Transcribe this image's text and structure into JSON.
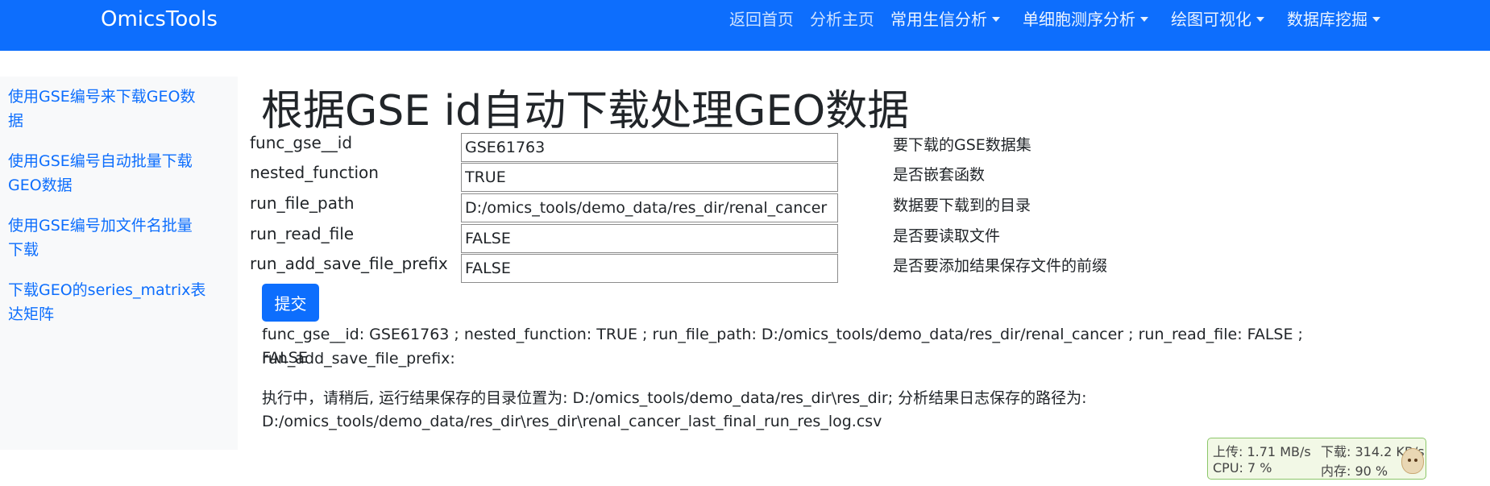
{
  "navbar": {
    "brand": "OmicsTools",
    "links": [
      "返回首页",
      "分析主页"
    ],
    "dropdowns": [
      "常用生信分析",
      "单细胞测序分析",
      "绘图可视化",
      "数据库挖掘"
    ]
  },
  "sidebar": {
    "items": [
      {
        "line1": "使用GSE编号来下载GEO数",
        "line2": "据"
      },
      {
        "line1": "使用GSE编号自动批量下载",
        "line2": "GEO数据"
      },
      {
        "line1": "使用GSE编号加文件名批量",
        "line2": "下载"
      },
      {
        "line1": "下载GEO的series_matrix表",
        "line2": "达矩阵"
      }
    ]
  },
  "page_title": "根据GSE id自动下载处理GEO数据",
  "form": {
    "rows": [
      {
        "label": "func_gse__id",
        "value": "GSE61763",
        "desc": "要下载的GSE数据集"
      },
      {
        "label": "nested_function",
        "value": "TRUE",
        "desc": "是否嵌套函数"
      },
      {
        "label": "run_file_path",
        "value": "D:/omics_tools/demo_data/res_dir/renal_cancer",
        "desc": "数据要下载到的目录"
      },
      {
        "label": "run_read_file",
        "value": "FALSE",
        "desc": "是否要读取文件"
      },
      {
        "label": "run_add_save_file_prefix",
        "value": "FALSE",
        "desc": "是否要添加结果保存文件的前缀"
      }
    ],
    "submit_label": "提交"
  },
  "output": {
    "params_line1": "func_gse__id: GSE61763 ; nested_function: TRUE ; run_file_path: D:/omics_tools/demo_data/res_dir/renal_cancer ; run_read_file: FALSE ; run_add_save_file_prefix:",
    "params_line2": "FALSE",
    "status_line1": "执行中，请稍后, 运行结果保存的目录位置为: D:/omics_tools/demo_data/res_dir\\res_dir; 分析结果日志保存的路径为:",
    "status_line2": "D:/omics_tools/demo_data/res_dir\\res_dir\\renal_cancer_last_final_run_res_log.csv"
  },
  "net_widget": {
    "upload": "上传: 1.71 MB/s",
    "download": "下载: 314.2 KB/s",
    "cpu": "CPU: 7 %",
    "memory": "内存: 90 %",
    "mascot_icon": "cat-mascot-icon"
  },
  "colors": {
    "primary": "#0d6efd",
    "sidebar_bg": "#f8f9fa",
    "widget_bg": "#f2f8e6",
    "widget_border": "#8cc76a"
  }
}
